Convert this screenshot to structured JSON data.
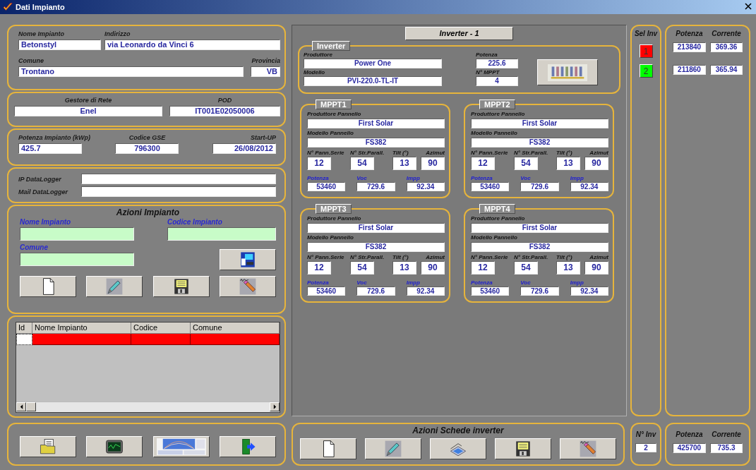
{
  "window": {
    "title": "Dati Impianto"
  },
  "plant": {
    "fields": [
      {
        "label": "Nome Impianto",
        "value": "Betonstyl"
      },
      {
        "label": "Indirizzo",
        "value": "via Leonardo da Vinci 6"
      },
      {
        "label": "Comune",
        "value": "Trontano"
      },
      {
        "label": "Provincia",
        "value": "VB"
      }
    ]
  },
  "grid_operator": {
    "fields": [
      {
        "label": "Gestore di Rete",
        "value": "Enel"
      },
      {
        "label": "POD",
        "value": "IT001E02050006"
      }
    ]
  },
  "registration": {
    "fields": [
      {
        "label": "Potenza Impianto (kWp)",
        "value": "425.7"
      },
      {
        "label": "Codice GSE",
        "value": "796300"
      },
      {
        "label": "Start-UP",
        "value": "26/08/2012"
      }
    ]
  },
  "datalogger": {
    "fields": [
      {
        "label": "IP DataLogger"
      },
      {
        "label": "Mail DataLogger"
      }
    ]
  },
  "plant_actions": {
    "title": "Azioni Impianto",
    "fields": [
      {
        "label": "Nome Impianto"
      },
      {
        "label": "Codice Impianto"
      },
      {
        "label": "Comune"
      }
    ]
  },
  "plant_table": {
    "columns": [
      "Id",
      "Nome Impianto",
      "Codice",
      "Comune"
    ],
    "rows": [
      {
        "selected": true
      }
    ]
  },
  "inverter_header": "Inverter - 1",
  "inverter": {
    "title": "Inverter",
    "fields": [
      {
        "label": "Produttore",
        "value": "Power One"
      },
      {
        "label": "Modello",
        "value": "PVI-220.0-TL-IT"
      },
      {
        "label": "Potenza",
        "value": "225.6"
      },
      {
        "label": "N° MPPT",
        "value": "4"
      }
    ]
  },
  "mppts": [
    {
      "title": "MPPT1",
      "panel": [
        {
          "label": "Produttore Pannello",
          "value": "First Solar"
        },
        {
          "label": "Modello Pannello",
          "value": "FS382"
        }
      ],
      "config": [
        {
          "label": "N° Pann.Serie",
          "value": "12"
        },
        {
          "label": "N° Str.Parall.",
          "value": "54"
        },
        {
          "label": "Tilt (°)",
          "value": "13"
        },
        {
          "label": "Azimut",
          "value": "90"
        }
      ],
      "output": [
        {
          "label": "Potenza",
          "value": "53460"
        },
        {
          "label": "Voc",
          "value": "729.6"
        },
        {
          "label": "Impp",
          "value": "92.34"
        }
      ]
    },
    {
      "title": "MPPT2",
      "panel": [
        {
          "label": "Produttore Pannello",
          "value": "First Solar"
        },
        {
          "label": "Modello Pannello",
          "value": "FS382"
        }
      ],
      "config": [
        {
          "label": "N° Pann.Serie",
          "value": "12"
        },
        {
          "label": "N° Str.Parall.",
          "value": "54"
        },
        {
          "label": "Tilt (°)",
          "value": "13"
        },
        {
          "label": "Azimut",
          "value": "90"
        }
      ],
      "output": [
        {
          "label": "Potenza",
          "value": "53460"
        },
        {
          "label": "Voc",
          "value": "729.6"
        },
        {
          "label": "Impp",
          "value": "92.34"
        }
      ]
    },
    {
      "title": "MPPT3",
      "panel": [
        {
          "label": "Produttore Pannello",
          "value": "First Solar"
        },
        {
          "label": "Modello Pannello",
          "value": "FS382"
        }
      ],
      "config": [
        {
          "label": "N° Pann.Serie",
          "value": "12"
        },
        {
          "label": "N° Str.Parall.",
          "value": "54"
        },
        {
          "label": "Tilt (°)",
          "value": "13"
        },
        {
          "label": "Azimut",
          "value": "90"
        }
      ],
      "output": [
        {
          "label": "Potenza",
          "value": "53460"
        },
        {
          "label": "Voc",
          "value": "729.6"
        },
        {
          "label": "Impp",
          "value": "92.34"
        }
      ]
    },
    {
      "title": "MPPT4",
      "panel": [
        {
          "label": "Produttore Pannello",
          "value": "First Solar"
        },
        {
          "label": "Modello Pannello",
          "value": "FS382"
        }
      ],
      "config": [
        {
          "label": "N° Pann.Serie",
          "value": "12"
        },
        {
          "label": "N° Str.Parall.",
          "value": "54"
        },
        {
          "label": "Tilt (°)",
          "value": "13"
        },
        {
          "label": "Azimut",
          "value": "90"
        }
      ],
      "output": [
        {
          "label": "Potenza",
          "value": "53460"
        },
        {
          "label": "Voc",
          "value": "729.6"
        },
        {
          "label": "Impp",
          "value": "92.34"
        }
      ]
    }
  ],
  "inverter_actions": {
    "title": "Azioni Schede inverter"
  },
  "inverter_list": {
    "title": "Sel Inv",
    "headers": [
      "Potenza",
      "Corrente"
    ],
    "items": [
      {
        "label": "1",
        "selected": true,
        "potenza": "213840",
        "corrente": "369.36"
      },
      {
        "label": "2",
        "selected": false,
        "potenza": "211860",
        "corrente": "365.94"
      }
    ]
  },
  "totals": {
    "count_label": "N° Inv",
    "count": "2",
    "headers": [
      "Potenza",
      "Corrente"
    ],
    "potenza": "425700",
    "corrente": "735.3"
  }
}
